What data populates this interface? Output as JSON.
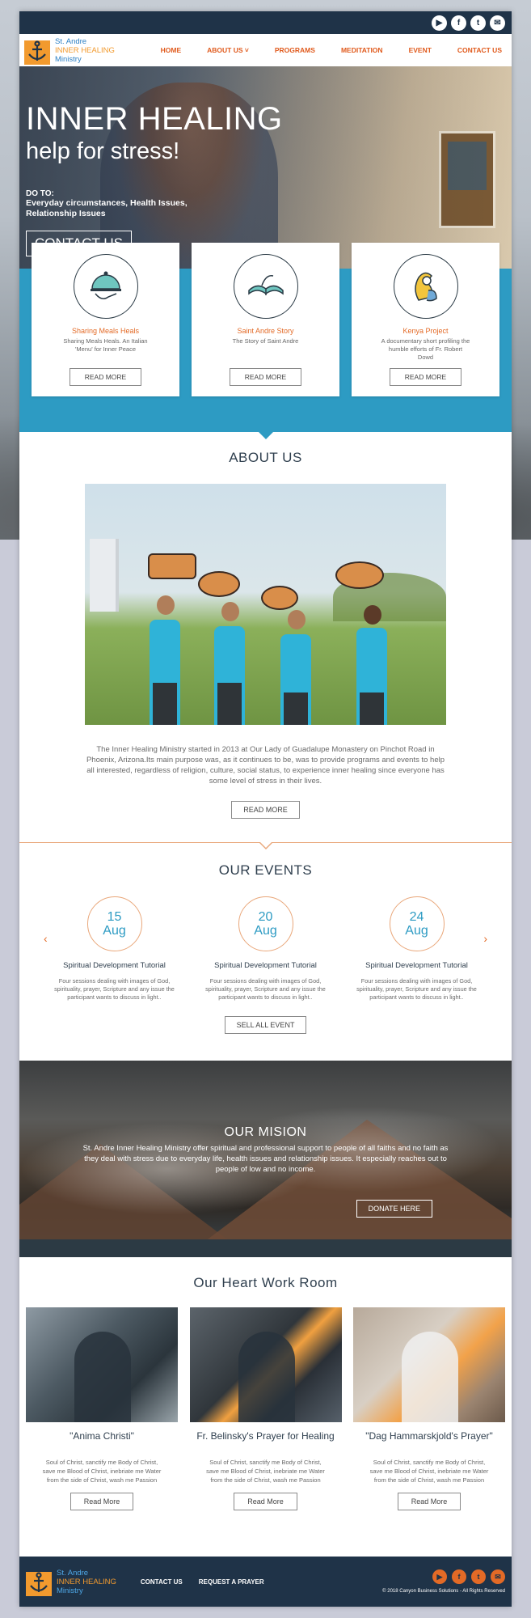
{
  "social": {
    "icons": [
      "youtube-icon",
      "facebook-icon",
      "twitter-icon",
      "email-icon"
    ],
    "glyphs": [
      "▶",
      "f",
      "t",
      "✉"
    ]
  },
  "brand": {
    "line1": "St. Andre",
    "line2": "INNER HEALING",
    "line3": "Ministry",
    "accent": "#e36a26",
    "blue": "#2d9bc3",
    "navy": "#1f3348"
  },
  "nav": {
    "items": [
      "HOME",
      "ABOUT US ˅",
      "PROGRAMS",
      "MEDITATION",
      "EVENT",
      "CONTACT US"
    ]
  },
  "hero": {
    "title": "INNER HEALING",
    "subtitle": "help for stress!",
    "do_label": "DO TO:",
    "description": "Everyday circumstances, Health Issues, Relationship Issues",
    "button": "CONTACT US"
  },
  "features": [
    {
      "title": "Sharing Meals Heals",
      "desc": "Sharing Meals Heals. An Italian 'Menu' for Inner Peace",
      "button": "READ MORE"
    },
    {
      "title": "Saint Andre Story",
      "desc": "The Story of Saint Andre",
      "button": "READ MORE"
    },
    {
      "title": "Kenya Project",
      "desc": "A documentary short profiling the humble efforts of Fr. Robert Dowd",
      "button": "READ MORE"
    }
  ],
  "about": {
    "title": "ABOUT US",
    "text": "The Inner Healing Ministry started in 2013 at Our Lady of Guadalupe Monastery on Pinchot Road in Phoenix, Arizona.Its main purpose was, as it continues to be, was to provide programs and events to help all interested, regardless of religion, culture, social status, to experience inner healing since everyone has some level of stress in their lives.",
    "button": "READ MORE"
  },
  "events": {
    "title": "OUR EVENTS",
    "items": [
      {
        "day": "15",
        "month": "Aug",
        "title": "Spiritual Development Tutorial",
        "desc": "Four sessions dealing with images of God, spirituality, prayer, Scripture and any issue the participant wants to discuss in light.."
      },
      {
        "day": "20",
        "month": "Aug",
        "title": "Spiritual Development Tutorial",
        "desc": "Four sessions dealing with images of God, spirituality, prayer, Scripture and any issue the participant wants to discuss in light.."
      },
      {
        "day": "24",
        "month": "Aug",
        "title": "Spiritual Development Tutorial",
        "desc": "Four sessions dealing with images of God, spirituality, prayer, Scripture and any issue the participant wants to discuss in light.."
      }
    ],
    "prev": "‹",
    "next": "›",
    "button": "SELL ALL EVENT"
  },
  "mission": {
    "title": "OUR MISION",
    "text": "St. Andre Inner Healing Ministry offer spiritual and professional support to people of all faiths and no faith as they deal with stress due to everyday life, health issues and relationship issues. It especially reaches out to people of low and no income.",
    "button": "DONATE HERE"
  },
  "heart": {
    "title": "Our Heart Work Room",
    "items": [
      {
        "title": "\"Anima Christi\"",
        "text": "Soul of Christ, sanctify me Body of Christ, save me Blood of Christ, inebriate me Water from the side of Christ, wash me Passion",
        "button": "Read More"
      },
      {
        "title": "Fr. Belinsky's Prayer for Healing",
        "text": "Soul of Christ, sanctify me Body of Christ, save me Blood of Christ, inebriate me Water from the side of Christ, wash me Passion",
        "button": "Read More"
      },
      {
        "title": "\"Dag Hammarskjold's Prayer\"",
        "text": "Soul of Christ, sanctify me Body of Christ, save me Blood of Christ, inebriate me Water from the side of Christ, wash me Passion",
        "button": "Read More"
      }
    ]
  },
  "footer": {
    "links": [
      "CONTACT US",
      "REQUEST A PRAYER"
    ],
    "social_icons": [
      "youtube-icon",
      "facebook-icon",
      "twitter-icon",
      "email-icon"
    ],
    "social_glyphs": [
      "▶",
      "f",
      "t",
      "✉"
    ],
    "copyright": "© 2018 Canyon Business Solutions - All Rights Reserved"
  }
}
